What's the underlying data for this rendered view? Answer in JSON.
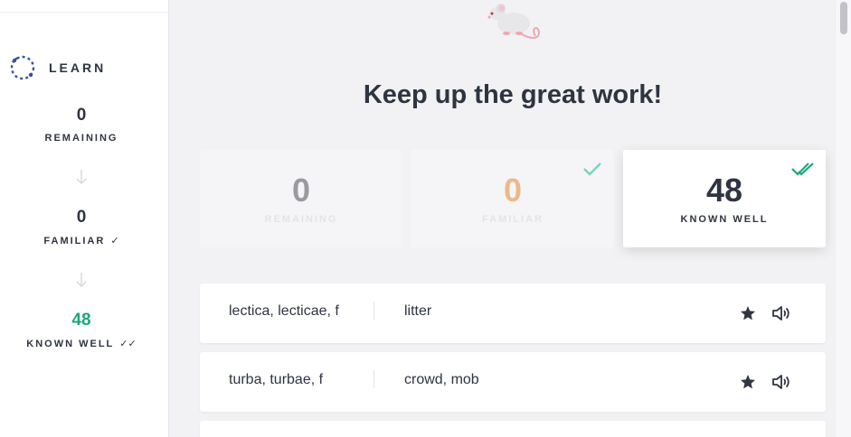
{
  "sidebar": {
    "learn_label": "LEARN",
    "remaining": {
      "value": "0",
      "label": "REMAINING"
    },
    "familiar": {
      "value": "0",
      "label": "FAMILIAR",
      "mark": "✓"
    },
    "known_well": {
      "value": "48",
      "label": "KNOWN WELL",
      "mark": "✓✓"
    }
  },
  "main": {
    "headline": "Keep up the great work!",
    "cards": [
      {
        "value": "0",
        "label": "REMAINING"
      },
      {
        "value": "0",
        "label": "FAMILIAR"
      },
      {
        "value": "48",
        "label": "KNOWN WELL"
      }
    ],
    "words": [
      {
        "term": "lectica, lecticae, f",
        "definition": "litter"
      },
      {
        "term": "turba, turbae, f",
        "definition": "crowd, mob"
      }
    ]
  },
  "colors": {
    "accent_green": "#1fa67a",
    "familiar_orange": "#ecb88b",
    "text_dark": "#2f3441",
    "background": "#f2f2f4"
  },
  "icons": {
    "learn": "learn-cycle-icon",
    "star": "star-icon",
    "speaker": "speaker-icon",
    "check": "check-icon",
    "double_check": "double-check-icon",
    "mascot": "mouse-mascot-icon"
  }
}
